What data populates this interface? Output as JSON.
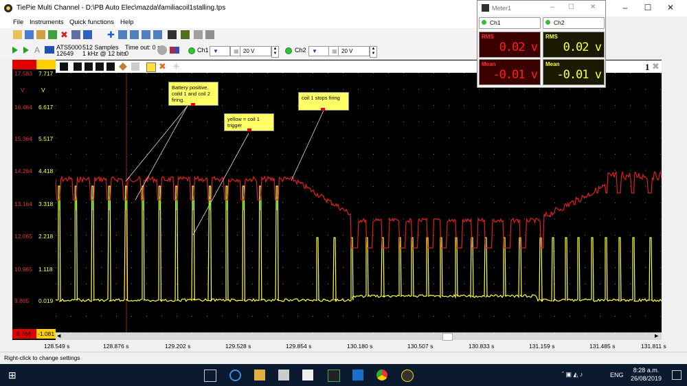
{
  "window": {
    "title": "TiePie Multi Channel - D:\\PB Auto Elec\\mazda\\familiacoil1stalling.tps"
  },
  "menu": [
    "File",
    "Instruments",
    "Quick functions",
    "Help"
  ],
  "instrument": {
    "model": "ATS5000",
    "serial": "12649",
    "samples": "512 Samples",
    "rate": "1 kHz @ 12 bits",
    "timeout_label": "Time out: 0 s",
    "timeout_value": "0"
  },
  "channels": [
    {
      "label": "Ch1",
      "range": "20 V"
    },
    {
      "label": "Ch2",
      "range": "20 V"
    }
  ],
  "scope": {
    "page_indicator": "1",
    "ch1_top": "17.583",
    "ch2_top": "7.717",
    "ch1_bottom": "8.766",
    "ch2_bottom": "-1.081",
    "y_units": [
      "V",
      "V"
    ],
    "y_ticks_ch1": [
      "16.464",
      "15.364",
      "14.264",
      "13.164",
      "12.065",
      "10.965",
      "9.865"
    ],
    "y_ticks_ch2": [
      "6.617",
      "5.517",
      "4.418",
      "3.318",
      "2.218",
      "1.118",
      "0.019"
    ],
    "x_ticks": [
      "128.549 s",
      "128.876 s",
      "129.202 s",
      "129.528 s",
      "129.854 s",
      "130.180 s",
      "130.507 s",
      "130.833 s",
      "131.159 s",
      "131.485 s",
      "131.811 s"
    ]
  },
  "annotations": [
    {
      "text": "Battery positive. coild 1 and coil 2 firing."
    },
    {
      "text": "yellow = coil 1 trigger"
    },
    {
      "text": "coil 1 stops firing"
    }
  ],
  "meter": {
    "title": "Meter1",
    "ch1_label": "Ch1",
    "ch2_label": "Ch2",
    "ch1_rms_label": "RMS",
    "ch1_rms": "0.02 v",
    "ch2_rms_label": "RMS",
    "ch2_rms": "0.02 v",
    "ch1_mean_label": "Mean",
    "ch1_mean": "-0.01 v",
    "ch2_mean_label": "Mean",
    "ch2_mean": "-0.01 v"
  },
  "statusbar": {
    "text": "Right-click to change settings"
  },
  "taskbar": {
    "lang": "ENG",
    "time": "8:28 a.m.",
    "date": "26/08/2019"
  },
  "colors": {
    "ch1": "#e02020",
    "ch2": "#ffff40",
    "green": "#20c020",
    "meter_red": "#ff2020",
    "meter_yellow": "#ffff40"
  }
}
